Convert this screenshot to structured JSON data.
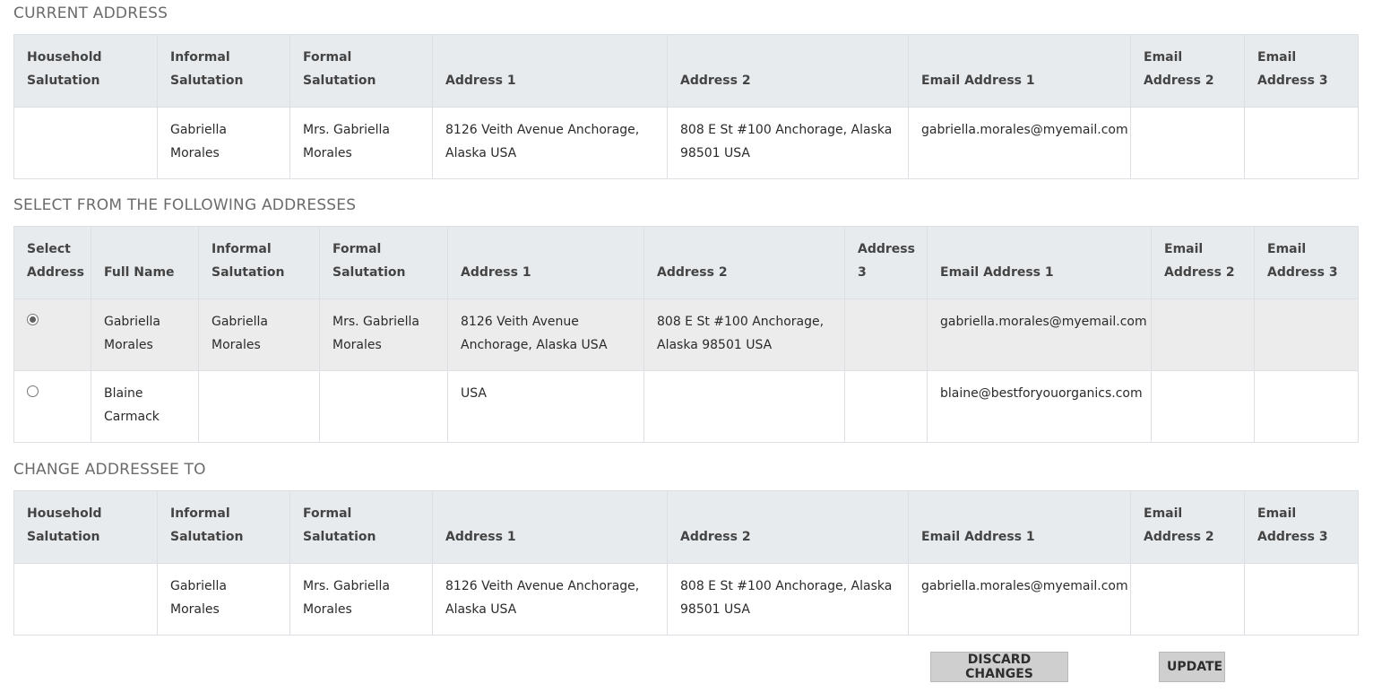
{
  "sections": {
    "current": "CURRENT ADDRESS",
    "select": "SELECT FROM THE FOLLOWING ADDRESSES",
    "change": "CHANGE ADDRESSEE TO"
  },
  "current_table": {
    "headers": [
      "Household Salutation",
      "Informal Salutation",
      "Formal Salutation",
      "Address 1",
      "Address 2",
      "Email Address 1",
      "Email Address 2",
      "Email Address 3"
    ],
    "row": [
      "",
      "Gabriella Morales",
      "Mrs. Gabriella Morales",
      "8126 Veith Avenue Anchorage, Alaska USA",
      "808 E St #100 Anchorage, Alaska 98501 USA",
      "gabriella.morales@myemail.com",
      "",
      ""
    ]
  },
  "select_table": {
    "headers": [
      "Select Address",
      "Full Name",
      "Informal Salutation",
      "Formal Salutation",
      "Address 1",
      "Address 2",
      "Address 3",
      "Email Address 1",
      "Email Address 2",
      "Email Address 3"
    ],
    "rows": [
      {
        "selected": true,
        "cells": [
          "Gabriella Morales",
          "Gabriella Morales",
          "Mrs. Gabriella Morales",
          "8126 Veith Avenue Anchorage, Alaska USA",
          "808 E St #100 Anchorage, Alaska 98501 USA",
          "",
          "gabriella.morales@myemail.com",
          "",
          ""
        ]
      },
      {
        "selected": false,
        "cells": [
          "Blaine Carmack",
          "",
          "",
          "USA",
          "",
          "",
          "blaine@bestforyouorganics.com",
          "",
          ""
        ]
      }
    ]
  },
  "change_table": {
    "headers": [
      "Household Salutation",
      "Informal Salutation",
      "Formal Salutation",
      "Address 1",
      "Address 2",
      "Email Address 1",
      "Email Address 2",
      "Email Address 3"
    ],
    "row": [
      "",
      "Gabriella Morales",
      "Mrs. Gabriella Morales",
      "8126 Veith Avenue Anchorage, Alaska USA",
      "808 E St #100 Anchorage, Alaska 98501 USA",
      "gabriella.morales@myemail.com",
      "",
      ""
    ]
  },
  "buttons": {
    "discard": "DISCARD CHANGES",
    "update": "UPDATE"
  }
}
